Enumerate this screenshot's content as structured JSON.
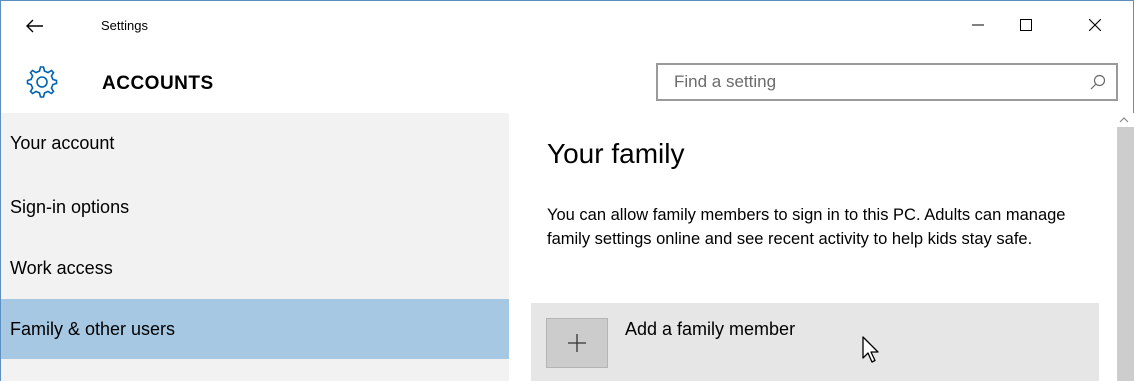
{
  "window": {
    "title": "Settings",
    "back_icon": "back-arrow-icon",
    "controls": {
      "minimize_icon": "minimize-icon",
      "maximize_icon": "maximize-icon",
      "close_icon": "close-icon"
    }
  },
  "header": {
    "icon": "gear-icon",
    "title": "ACCOUNTS",
    "search": {
      "placeholder": "Find a setting",
      "value": "",
      "icon": "search-icon"
    }
  },
  "sidebar": {
    "items": [
      {
        "label": "Your account",
        "selected": false
      },
      {
        "label": "Sign-in options",
        "selected": false
      },
      {
        "label": "Work access",
        "selected": false
      },
      {
        "label": "Family & other users",
        "selected": true
      }
    ]
  },
  "main": {
    "title": "Your family",
    "description": "You can allow family members to sign in to this PC. Adults can manage family settings online and see recent activity to help kids stay safe.",
    "add_member": {
      "label": "Add a family member",
      "icon": "plus-icon"
    }
  },
  "colors": {
    "selected_nav": "#a6c8e2",
    "sidebar_bg": "#f2f2f2",
    "card_bg": "#e6e6e6",
    "window_border": "#5e8fbf",
    "accent_icon": "#0063b1"
  }
}
